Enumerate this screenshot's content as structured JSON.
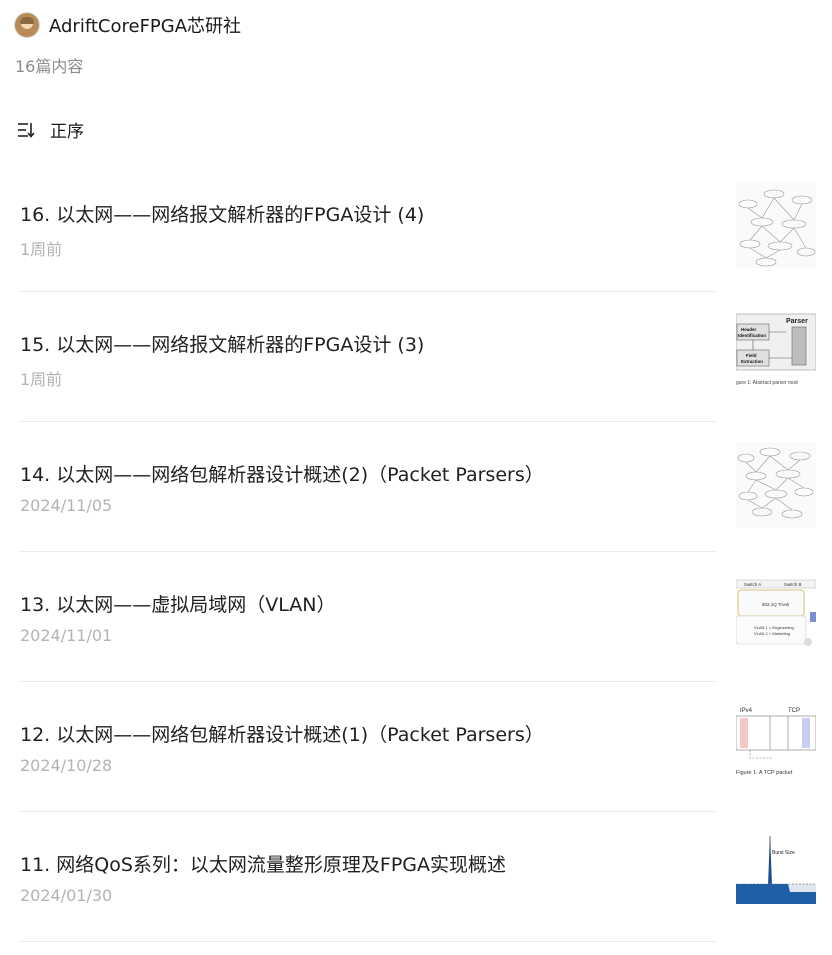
{
  "author": {
    "name": "AdriftCoreFPGA芯研社",
    "avatar_icon": "avatar-image"
  },
  "content_count": "16篇内容",
  "sort": {
    "icon": "sort-order-icon",
    "label": "正序"
  },
  "articles": [
    {
      "title": "16. 以太网——网络报文解析器的FPGA设计 (4)",
      "date": "1周前",
      "thumb": "graph-diagram-thumbnail"
    },
    {
      "title": "15. 以太网——网络报文解析器的FPGA设计 (3)",
      "date": "1周前",
      "thumb": "parser-block-diagram-thumbnail",
      "thumb_text": {
        "parser": "Parser",
        "header": "Header",
        "ident": "Identification",
        "field": "Field",
        "extract": "Extraction",
        "caption": "gure 1: Abstract parser mod"
      }
    },
    {
      "title": "14. 以太网——网络包解析器设计概述(2)（Packet Parsers）",
      "date": "2024/11/05",
      "thumb": "graph-diagram-thumbnail"
    },
    {
      "title": "13. 以太网——虚拟局域网（VLAN）",
      "date": "2024/11/01",
      "thumb": "vlan-switch-diagram-thumbnail",
      "thumb_text": {
        "switch_a": "Switch A",
        "switch_b": "Switch B",
        "trunk": "802.1Q Trunk",
        "vlan1": "VLAN 1 = Engineering",
        "vlan2": "VLAN 2 = Marketing"
      }
    },
    {
      "title": "12. 以太网——网络包解析器设计概述(1)（Packet Parsers）",
      "date": "2024/10/28",
      "thumb": "tcp-packet-diagram-thumbnail",
      "thumb_text": {
        "ipv4": "IPv4",
        "tcp": "TCP",
        "caption": "Figure 1:  A TCP packet"
      }
    },
    {
      "title": "11. 网络QoS系列：以太网流量整形原理及FPGA实现概述",
      "date": "2024/01/30",
      "thumb": "burst-size-chart-thumbnail",
      "thumb_text": {
        "burst": "Burst Size"
      }
    }
  ],
  "colors": {
    "date": "#b3b3b3",
    "divider": "#ececec",
    "title": "#1f1f1f",
    "burst_blue": "#1f5fa8"
  }
}
